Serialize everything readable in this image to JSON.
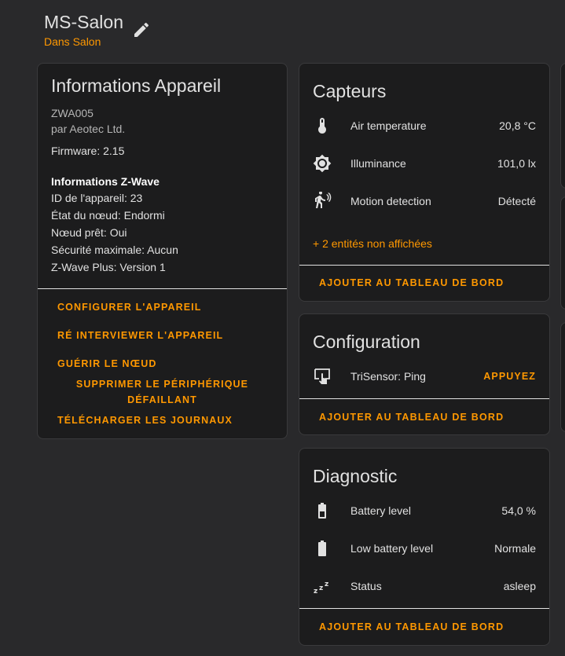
{
  "header": {
    "title": "MS-Salon",
    "area": "Dans Salon"
  },
  "device_info": {
    "title": "Informations Appareil",
    "model": "ZWA005",
    "manufacturer": "par Aeotec Ltd.",
    "firmware": "Firmware: 2.15",
    "zwave_heading": "Informations Z-Wave",
    "zwave_lines": [
      "ID de l'appareil: 23",
      "État du nœud: Endormi",
      "Nœud prêt: Oui",
      "Sécurité maximale: Aucun",
      "Z-Wave Plus: Version 1"
    ],
    "actions": {
      "configure": "CONFIGURER L'APPAREIL",
      "reinterview": "RÉ INTERVIEWER L'APPAREIL",
      "heal": "GUÉRIR LE NŒUD",
      "remove_failed_1": "SUPPRIMER LE PÉRIPHÉRIQUE",
      "remove_failed_2": "DÉFAILLANT",
      "download_logs": "TÉLÉCHARGER LES JOURNAUX"
    }
  },
  "sensors": {
    "title": "Capteurs",
    "rows": [
      {
        "icon": "thermometer-icon",
        "name": "Air temperature",
        "value": "20,8 °C"
      },
      {
        "icon": "brightness-icon",
        "name": "Illuminance",
        "value": "101,0 lx"
      },
      {
        "icon": "motion-sensor-icon",
        "name": "Motion detection",
        "value": "Détecté"
      }
    ],
    "hidden_entities": "+ 2 entités non affichées",
    "add_to_dashboard": "AJOUTER AU TABLEAU DE BORD"
  },
  "configuration": {
    "title": "Configuration",
    "rows": [
      {
        "icon": "gesture-tap-icon",
        "name": "TriSensor: Ping",
        "action": "APPUYEZ"
      }
    ],
    "add_to_dashboard": "AJOUTER AU TABLEAU DE BORD"
  },
  "diagnostic": {
    "title": "Diagnostic",
    "rows": [
      {
        "icon": "battery-icon",
        "name": "Battery level",
        "value": "54,0 %"
      },
      {
        "icon": "battery-full-icon",
        "name": "Low battery level",
        "value": "Normale"
      },
      {
        "icon": "sleep-icon",
        "name": "Status",
        "value": "asleep"
      }
    ],
    "add_to_dashboard": "AJOUTER AU TABLEAU DE BORD"
  },
  "colors": {
    "accent": "#ff9800",
    "background": "#29292b",
    "card": "#1c1c1d",
    "text": "#e1e1e1"
  }
}
